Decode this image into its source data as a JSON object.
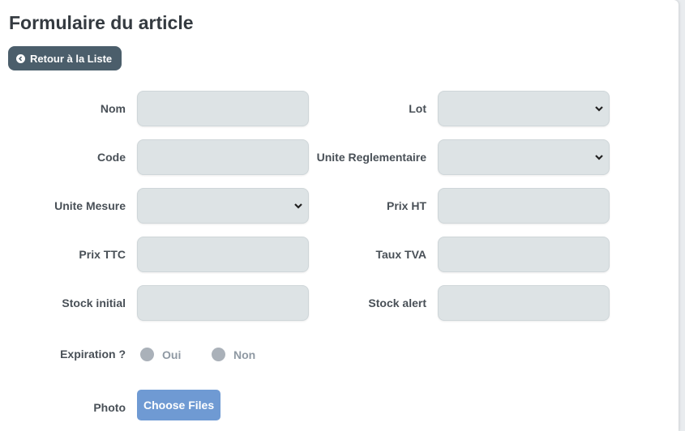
{
  "page": {
    "title": "Formulaire du article"
  },
  "back_button": {
    "label": "Retour à la Liste",
    "icon": "circle-chevron-left-icon"
  },
  "fields": {
    "nom": {
      "label": "Nom",
      "value": ""
    },
    "lot": {
      "label": "Lot",
      "value": ""
    },
    "code": {
      "label": "Code",
      "value": ""
    },
    "unite_reglementaire": {
      "label": "Unite Reglementaire",
      "value": ""
    },
    "unite_mesure": {
      "label": "Unite Mesure",
      "value": ""
    },
    "prix_ht": {
      "label": "Prix HT",
      "value": ""
    },
    "prix_ttc": {
      "label": "Prix TTC",
      "value": ""
    },
    "taux_tva": {
      "label": "Taux TVA",
      "value": ""
    },
    "stock_initial": {
      "label": "Stock initial",
      "value": ""
    },
    "stock_alert": {
      "label": "Stock alert",
      "value": ""
    }
  },
  "expiration": {
    "label": "Expiration ?",
    "options": [
      "Oui",
      "Non"
    ],
    "selected": null
  },
  "photo": {
    "label": "Photo",
    "button_label": "Choose Files"
  },
  "colors": {
    "back_button": "#4b5e6b",
    "field_bg": "#dde3e5",
    "choose_button": "#6f9ad3",
    "radio": "#aab1b9"
  }
}
